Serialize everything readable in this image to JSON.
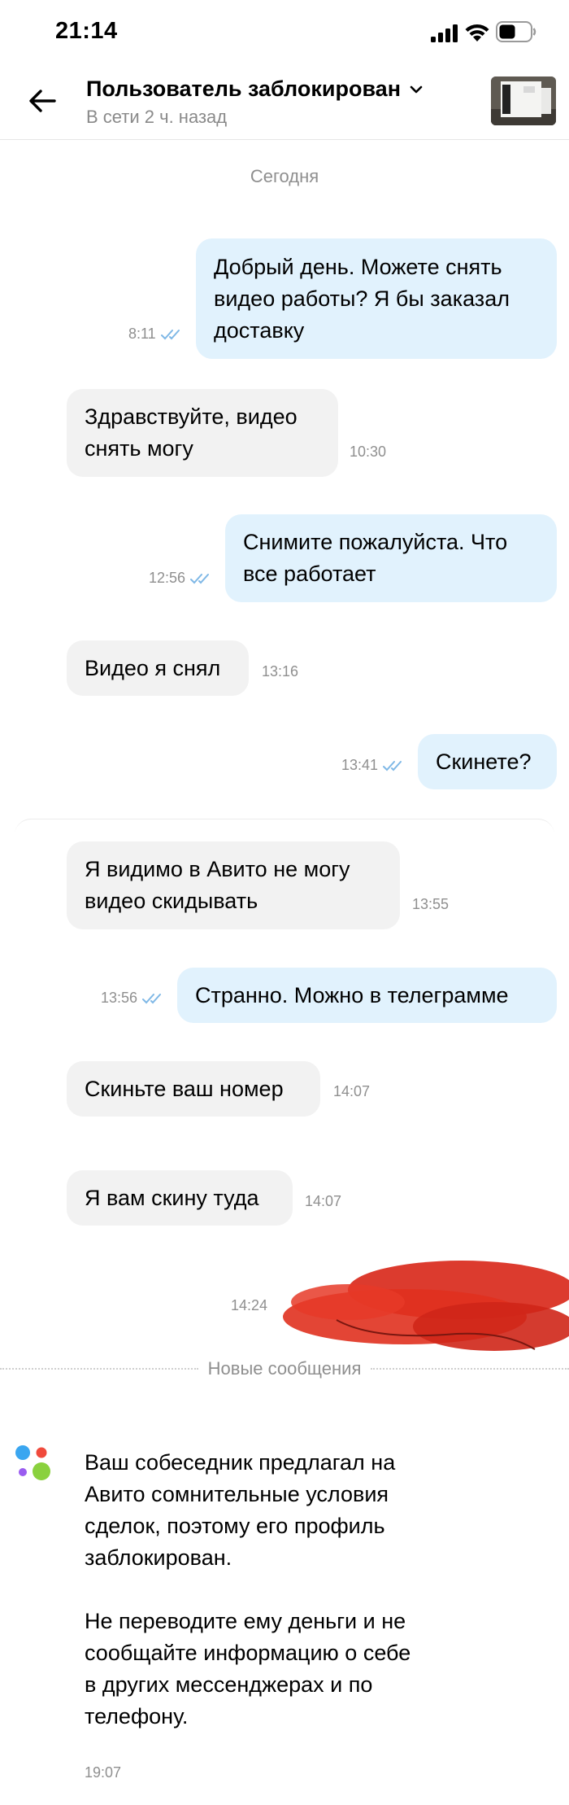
{
  "status_bar": {
    "time": "21:14",
    "icons": [
      "signal-icon",
      "wifi-icon",
      "battery-icon"
    ]
  },
  "header": {
    "title": "Пользователь заблокирован",
    "subtitle": "В сети 2 ч. назад",
    "icons": [
      "back-arrow-icon",
      "chevron-down-icon"
    ]
  },
  "date_divider": "Сегодня",
  "messages": [
    {
      "dir": "out",
      "lines": [
        "Добрый день. Можете снять",
        "видео работы? Я бы заказал",
        "доставку"
      ],
      "time": "8:11",
      "read": true
    },
    {
      "dir": "in",
      "lines": [
        "Здравствуйте, видео",
        "снять могу"
      ],
      "time": "10:30"
    },
    {
      "dir": "out",
      "lines": [
        "Снимите пожалуйста. Что",
        "все работает"
      ],
      "time": "12:56",
      "read": true
    },
    {
      "dir": "in",
      "lines": [
        "Видео я снял"
      ],
      "time": "13:16"
    },
    {
      "dir": "out",
      "lines": [
        "Скинете?"
      ],
      "time": "13:41",
      "read": true
    },
    {
      "dir": "in",
      "lines": [
        "Я видимо в Авито не могу",
        "видео скидывать"
      ],
      "time": "13:55"
    },
    {
      "dir": "out",
      "lines": [
        "Странно. Можно в телеграмме"
      ],
      "time": "13:56",
      "read": true
    },
    {
      "dir": "in",
      "lines": [
        "Скиньте ваш номер"
      ],
      "time": "14:07"
    },
    {
      "dir": "in",
      "lines": [
        "Я вам скину туда"
      ],
      "time": "14:07"
    },
    {
      "dir": "out",
      "lines": [],
      "time": "14:24",
      "redacted": true
    }
  ],
  "new_messages_divider": "Новые сообщения",
  "system_message": {
    "paragraphs": [
      [
        "Ваш собеседник предлагал на",
        "Авито сомнительные условия",
        "сделок, поэтому его профиль",
        "заблокирован."
      ],
      [
        "Не переводите ему деньги и не",
        "сообщайте информацию о себе",
        "в других мессенджерах и по",
        "телефону."
      ]
    ],
    "time": "19:07"
  },
  "colors": {
    "outgoing_bubble": "#e1f2fd",
    "incoming_bubble": "#f2f2f2",
    "read_checks": "#7fb8e6",
    "redaction": "#d92a1c",
    "logo_blue": "#3aa6f0",
    "logo_red": "#f04a3c",
    "logo_purple": "#9a5cf0",
    "logo_green": "#8ad13e"
  }
}
